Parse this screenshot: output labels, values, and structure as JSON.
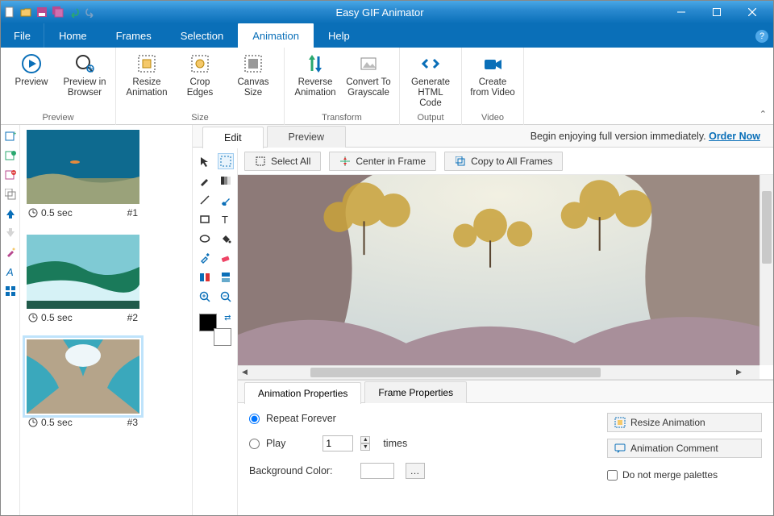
{
  "app": {
    "title": "Easy GIF Animator"
  },
  "tabs": {
    "file": "File",
    "home": "Home",
    "frames": "Frames",
    "selection": "Selection",
    "animation": "Animation",
    "help": "Help"
  },
  "ribbon": {
    "preview": {
      "preview": "Preview",
      "preview_browser": "Preview in Browser",
      "group": "Preview"
    },
    "size": {
      "resize": "Resize Animation",
      "crop": "Crop Edges",
      "canvas": "Canvas Size",
      "group": "Size"
    },
    "transform": {
      "reverse": "Reverse Animation",
      "grayscale": "Convert To Grayscale",
      "group": "Transform"
    },
    "output": {
      "html": "Generate HTML Code",
      "group": "Output"
    },
    "video": {
      "create": "Create from Video",
      "group": "Video"
    }
  },
  "promo": {
    "text": "Begin enjoying full version immediately. ",
    "link": "Order Now"
  },
  "editor_tabs": {
    "edit": "Edit",
    "preview": "Preview"
  },
  "actions": {
    "select_all": "Select All",
    "center": "Center in Frame",
    "copy_all": "Copy to All Frames"
  },
  "frames": [
    {
      "time": "0.5 sec",
      "idx": "#1"
    },
    {
      "time": "0.5 sec",
      "idx": "#2"
    },
    {
      "time": "0.5 sec",
      "idx": "#3"
    }
  ],
  "props": {
    "tab_anim": "Animation Properties",
    "tab_frame": "Frame Properties",
    "repeat": "Repeat Forever",
    "play": "Play",
    "play_value": "1",
    "times": "times",
    "bgcolor": "Background Color:",
    "resize": "Resize Animation",
    "comment": "Animation Comment",
    "merge": "Do not merge palettes"
  }
}
